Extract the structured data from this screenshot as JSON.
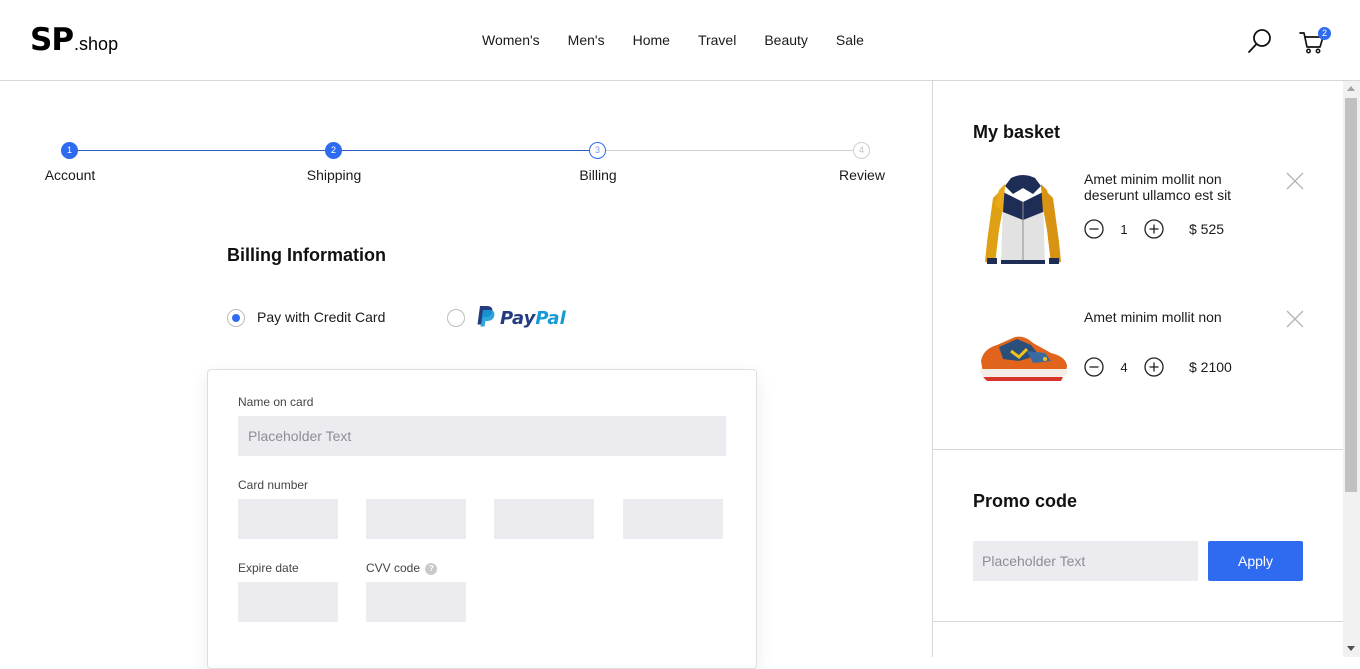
{
  "header": {
    "logo_main": "SP",
    "logo_suffix": ".shop",
    "nav": [
      "Women's",
      "Men's",
      "Home",
      "Travel",
      "Beauty",
      "Sale"
    ],
    "cart_count": "2"
  },
  "stepper": {
    "steps": [
      {
        "number": "1",
        "label": "Account",
        "state": "done"
      },
      {
        "number": "2",
        "label": "Shipping",
        "state": "done"
      },
      {
        "number": "3",
        "label": "Billing",
        "state": "current"
      },
      {
        "number": "4",
        "label": "Review",
        "state": "todo"
      }
    ]
  },
  "billing": {
    "title": "Billing Information",
    "option_credit_card": "Pay with Credit Card",
    "option_paypal_pay": "Pay",
    "option_paypal_pal": "Pal",
    "selected_option": "credit_card",
    "name_label": "Name on card",
    "name_placeholder": "Placeholder Text",
    "card_number_label": "Card number",
    "expire_label": "Expire date",
    "cvv_label": "CVV code",
    "cvv_help": "?"
  },
  "basket": {
    "title": "My basket",
    "items": [
      {
        "name": "Amet minim mollit non deserunt ullamco est sit",
        "quantity": "1",
        "price": "$ 525",
        "image": "yellow-jacket"
      },
      {
        "name": "Amet minim mollit non",
        "quantity": "4",
        "price": "$ 2100",
        "image": "sneaker"
      }
    ]
  },
  "promo": {
    "title": "Promo code",
    "placeholder": "Placeholder Text",
    "apply_label": "Apply"
  },
  "colors": {
    "accent": "#2f6bf0",
    "step_line": "#2c5fbf",
    "field_bg": "#ececf0",
    "paypal_dark": "#253b80",
    "paypal_light": "#179bd7"
  }
}
